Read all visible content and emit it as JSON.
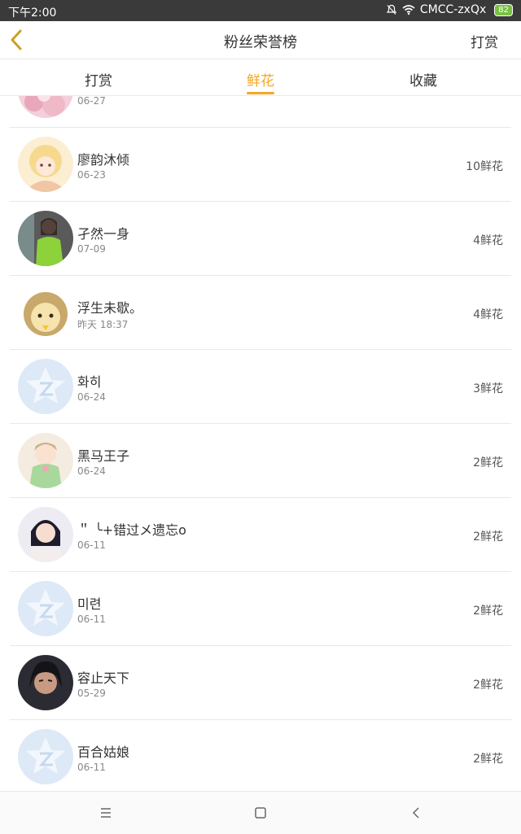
{
  "status_bar": {
    "time": "下午2:00",
    "carrier": "CMCC-zxQx",
    "battery": "82",
    "icons": [
      "bell-mute-icon",
      "wifi-icon"
    ]
  },
  "header": {
    "back_icon": "chevron-left-icon",
    "title": "粉丝荣誉榜",
    "action_label": "打赏"
  },
  "tabs": [
    {
      "label": "打赏",
      "active": false
    },
    {
      "label": "鲜花",
      "active": true
    },
    {
      "label": "收藏",
      "active": false
    }
  ],
  "colors": {
    "accent": "#f5a623",
    "status_bar": "#3a3a3a",
    "default_avatar": "#dde9f7"
  },
  "list": [
    {
      "name": "",
      "date": "06-27",
      "count": "",
      "avatar": "pink-flower-avatar"
    },
    {
      "name": "廖韵沐倾",
      "date": "06-23",
      "count": "10鲜花",
      "avatar": "anime-girl-avatar"
    },
    {
      "name": "孑然一身",
      "date": "07-09",
      "count": "4鲜花",
      "avatar": "green-girl-avatar"
    },
    {
      "name": "浮生未歇。",
      "date": "昨天 18:37",
      "count": "4鲜花",
      "avatar": "cartoon-bear-avatar"
    },
    {
      "name": "화히",
      "date": "06-24",
      "count": "3鲜花",
      "avatar": "default-qq-avatar"
    },
    {
      "name": "黑马王子",
      "date": "06-24",
      "count": "2鲜花",
      "avatar": "anime-boy-avatar"
    },
    {
      "name": "＂ ╰+错过メ遗忘o",
      "date": "06-11",
      "count": "2鲜花",
      "avatar": "girl-photo-avatar"
    },
    {
      "name": "미련",
      "date": "06-11",
      "count": "2鲜花",
      "avatar": "default-qq-avatar"
    },
    {
      "name": "容止天下",
      "date": "05-29",
      "count": "2鲜花",
      "avatar": "warrior-avatar"
    },
    {
      "name": "百合姑娘",
      "date": "06-11",
      "count": "2鲜花",
      "avatar": "default-qq-avatar"
    }
  ],
  "nav_bar": {
    "icons": [
      "menu-icon",
      "home-icon",
      "back-icon"
    ]
  }
}
